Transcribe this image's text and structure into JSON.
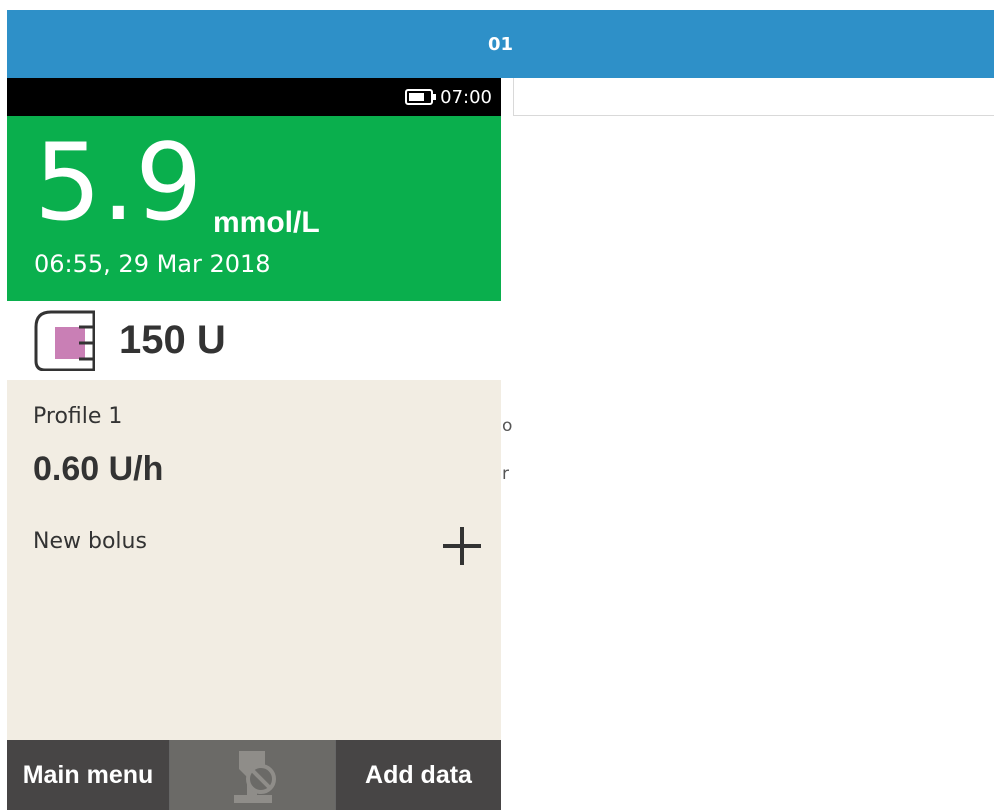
{
  "top_bar": {
    "label": "01"
  },
  "background_fragments": [
    "o",
    "r"
  ],
  "device": {
    "status_bar": {
      "battery_icon": "battery-icon",
      "time": "07:00"
    },
    "glucose": {
      "value": "5.9",
      "unit": "mmol/L",
      "timestamp": "06:55, 29 Mar 2018"
    },
    "reservoir": {
      "icon": "insulin-cartridge-icon",
      "value": "150 U"
    },
    "basal": {
      "profile": "Profile 1",
      "rate": "0.60 U/h"
    },
    "bolus": {
      "label": "New bolus",
      "icon": "plus-icon"
    },
    "bottom_bar": {
      "main_menu": "Main menu",
      "middle_icon": "pump-stopped-icon",
      "add_data": "Add data"
    }
  },
  "colors": {
    "top_bar": "#2e90c8",
    "glucose_in_range": "#0aaf4d",
    "cartridge_fill": "#c97fb5",
    "panel_bg": "#f2ede3"
  }
}
